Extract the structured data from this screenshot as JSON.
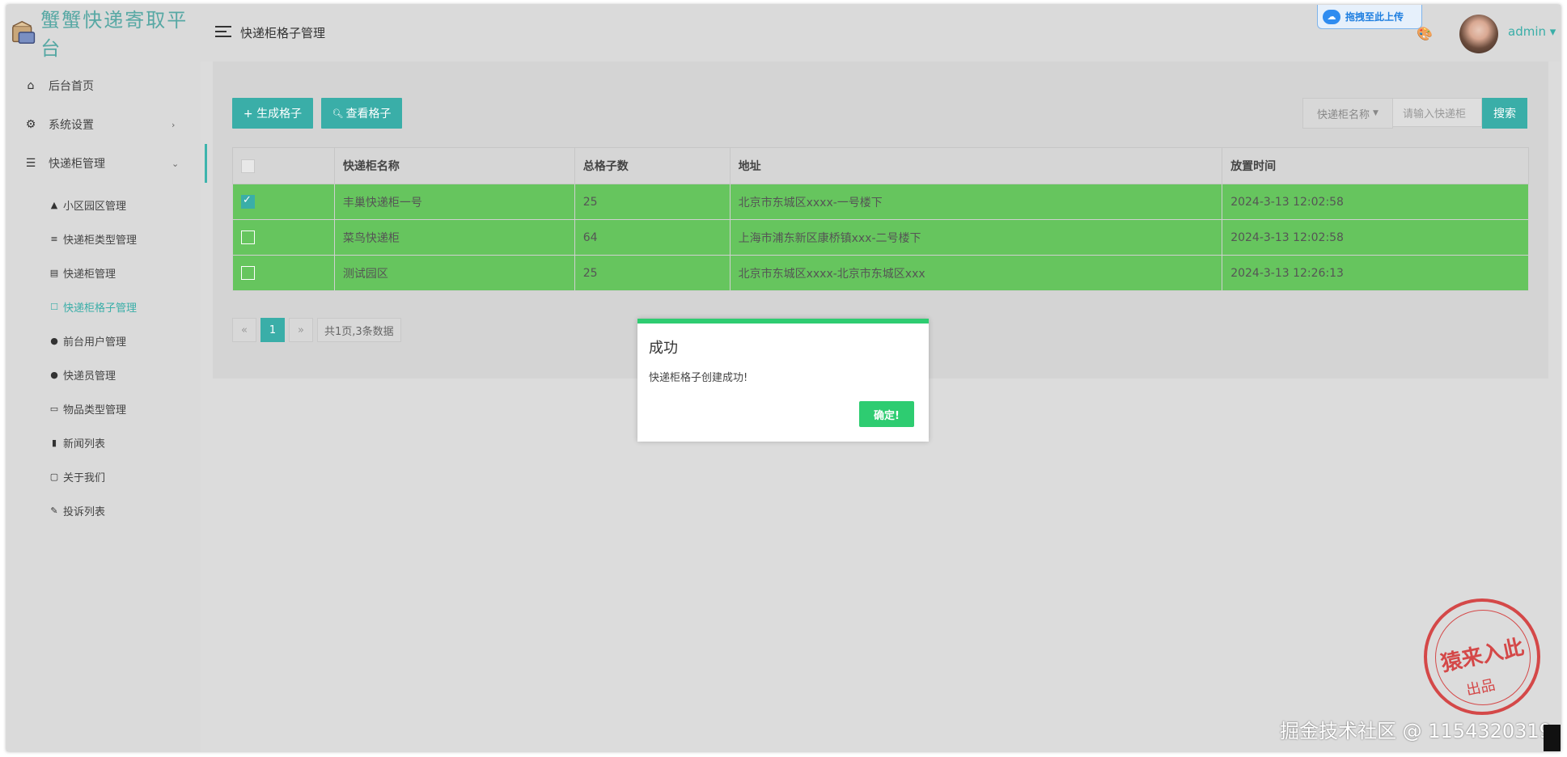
{
  "brand": {
    "title": "蟹蟹快递寄取平台"
  },
  "sidebar": {
    "items": [
      {
        "label": "后台首页",
        "icon": "home-icon"
      },
      {
        "label": "系统设置",
        "icon": "gear-icon",
        "arrow": "›"
      },
      {
        "label": "快递柜管理",
        "icon": "list-icon",
        "arrow": "⌄"
      }
    ],
    "subitems": [
      {
        "label": "小区园区管理",
        "icon": "navigation-icon"
      },
      {
        "label": "快递柜类型管理",
        "icon": "menu-lines-icon"
      },
      {
        "label": "快递柜管理",
        "icon": "inbox-icon"
      },
      {
        "label": "快递柜格子管理",
        "icon": "square-icon"
      },
      {
        "label": "前台用户管理",
        "icon": "user-icon"
      },
      {
        "label": "快递员管理",
        "icon": "user-icon"
      },
      {
        "label": "物品类型管理",
        "icon": "folder-icon"
      },
      {
        "label": "新闻列表",
        "icon": "file-icon"
      },
      {
        "label": "关于我们",
        "icon": "comment-icon"
      },
      {
        "label": "投诉列表",
        "icon": "pencil-icon"
      }
    ]
  },
  "header": {
    "page_title": "快递柜格子管理",
    "upload_label": "拖拽至此上传",
    "user": "admin"
  },
  "toolbar": {
    "generate_label": "+ 生成格子",
    "view_label": "查看格子",
    "search_field": "快递柜名称",
    "search_placeholder": "请输入快递柜",
    "search_button": "搜索"
  },
  "table": {
    "columns": [
      "快递柜名称",
      "总格子数",
      "地址",
      "放置时间"
    ],
    "rows": [
      {
        "name": "丰巢快递柜一号",
        "total": "25",
        "address": "北京市东城区xxxx-一号楼下",
        "time": "2024-3-13 12:02:58",
        "checked": true
      },
      {
        "name": "菜鸟快递柜",
        "total": "64",
        "address": "上海市浦东新区康桥镇xxx-二号楼下",
        "time": "2024-3-13 12:02:58",
        "checked": false
      },
      {
        "name": "测试园区",
        "total": "25",
        "address": "北京市东城区xxxx-北京市东城区xxx",
        "time": "2024-3-13 12:26:13",
        "checked": false
      }
    ]
  },
  "pager": {
    "prev": "«",
    "current": "1",
    "next": "»",
    "info": "共1页,3条数据"
  },
  "dialog": {
    "title": "成功",
    "message": "快递柜格子创建成功!",
    "ok_label": "确定!"
  },
  "stamp": {
    "line1": "猿来入此",
    "line2": "出品"
  },
  "watermark": "掘金技术社区 @ 1154320319",
  "colors": {
    "accent": "#3aaea8",
    "success": "#2ecc71",
    "row_green": "#66c55e"
  }
}
